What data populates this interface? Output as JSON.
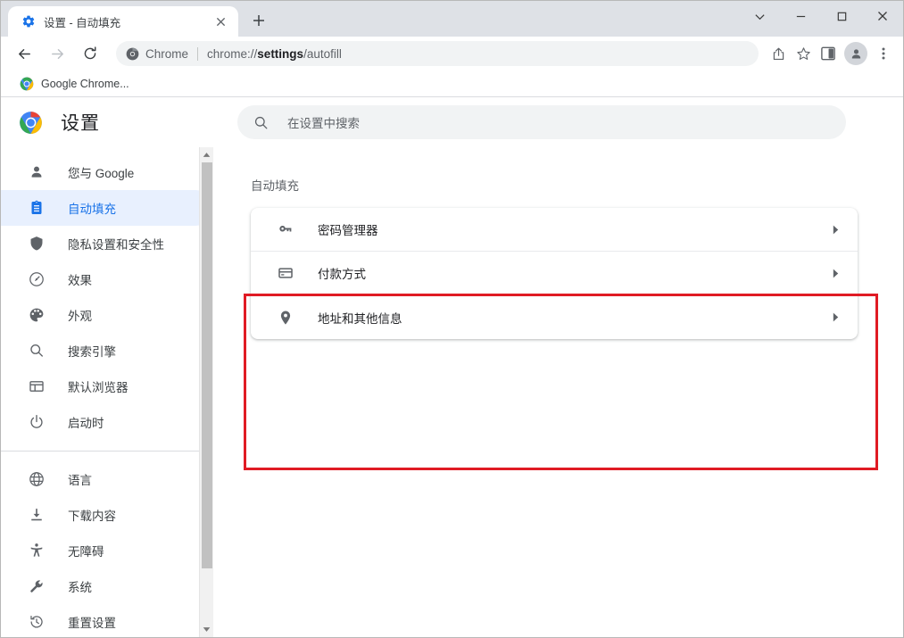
{
  "window": {
    "controls": {
      "tab_search_label": "chevron-down",
      "minimize_label": "—",
      "maximize_label": "□",
      "close_label": "✕"
    }
  },
  "tabstrip": {
    "tabs": [
      {
        "title": "设置 - 自动填充",
        "favicon": "settings-gear-icon",
        "close_label": "✕"
      }
    ],
    "new_tab_label": "+"
  },
  "toolbar": {
    "back_label": "back-arrow",
    "forward_label": "forward-arrow",
    "reload_label": "reload",
    "omnibox": {
      "chip_icon": "chrome-logo-icon",
      "chip_label": "Chrome",
      "url_prefix": "chrome://",
      "url_bold": "settings",
      "url_suffix": "/autofill",
      "full_url": "chrome://settings/autofill"
    },
    "share_label": "share-icon",
    "bookmark_label": "star-icon",
    "sidepanel_label": "side-panel-icon",
    "profile_label": "profile-avatar",
    "menu_label": "three-dot-menu"
  },
  "bookmarks": {
    "items": [
      {
        "label": "Google Chrome...",
        "favicon": "chrome-logo-icon"
      }
    ]
  },
  "settings": {
    "brand_title": "设置",
    "logo": "chrome-logo-icon",
    "search": {
      "placeholder": "在设置中搜索",
      "value": "",
      "icon": "search-icon"
    },
    "sidebar": {
      "items": [
        {
          "label": "您与 Google",
          "icon": "person-icon",
          "active": false
        },
        {
          "label": "自动填充",
          "icon": "clipboard-icon",
          "active": true
        },
        {
          "label": "隐私设置和安全性",
          "icon": "shield-icon",
          "active": false
        },
        {
          "label": "效果",
          "icon": "speedometer-icon",
          "active": false
        },
        {
          "label": "外观",
          "icon": "palette-icon",
          "active": false
        },
        {
          "label": "搜索引擎",
          "icon": "search-icon",
          "active": false
        },
        {
          "label": "默认浏览器",
          "icon": "browser-window-icon",
          "active": false
        },
        {
          "label": "启动时",
          "icon": "power-icon",
          "active": false
        }
      ],
      "items_secondary": [
        {
          "label": "语言",
          "icon": "globe-icon",
          "active": false
        },
        {
          "label": "下载内容",
          "icon": "download-icon",
          "active": false
        },
        {
          "label": "无障碍",
          "icon": "accessibility-icon",
          "active": false
        },
        {
          "label": "系统",
          "icon": "wrench-icon",
          "active": false
        },
        {
          "label": "重置设置",
          "icon": "restore-icon",
          "active": false
        }
      ]
    },
    "main": {
      "section_title": "自动填充",
      "rows": [
        {
          "label": "密码管理器",
          "icon": "key-icon",
          "chevron": "chevron-right-icon"
        },
        {
          "label": "付款方式",
          "icon": "credit-card-icon",
          "chevron": "chevron-right-icon"
        },
        {
          "label": "地址和其他信息",
          "icon": "location-pin-icon",
          "chevron": "chevron-right-icon"
        }
      ]
    }
  },
  "annotation": {
    "highlight_color": "#e01b24",
    "description": "red-rectangle-highlight-around-autofill-card"
  },
  "colors": {
    "accent_blue": "#1a73e8",
    "active_bg": "#e8f0fe",
    "tabstrip_bg": "#dee1e6",
    "omnibox_bg": "#f1f3f4",
    "text_primary": "#202124",
    "text_secondary": "#5f6368",
    "divider": "#dadce0"
  }
}
